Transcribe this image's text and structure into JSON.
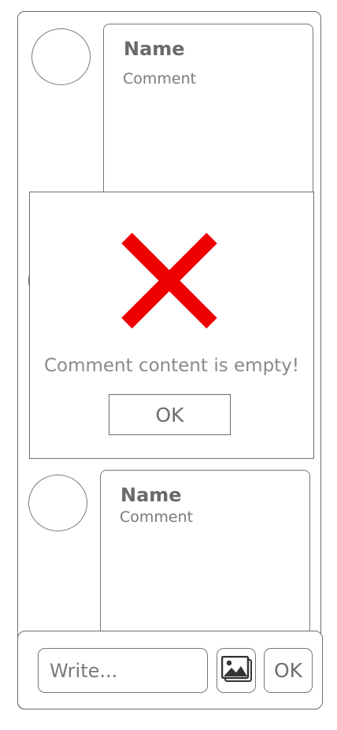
{
  "comments": [
    {
      "name": "Name",
      "comment": "Comment"
    },
    {
      "name": "Name",
      "comment": "Comment"
    }
  ],
  "composer": {
    "placeholder": "Write...",
    "image_icon": "image-gallery-icon",
    "ok_label": "OK"
  },
  "dialog": {
    "icon": "error-x-icon",
    "icon_color": "#ee0000",
    "message": "Comment content is empty!",
    "ok_label": "OK"
  }
}
